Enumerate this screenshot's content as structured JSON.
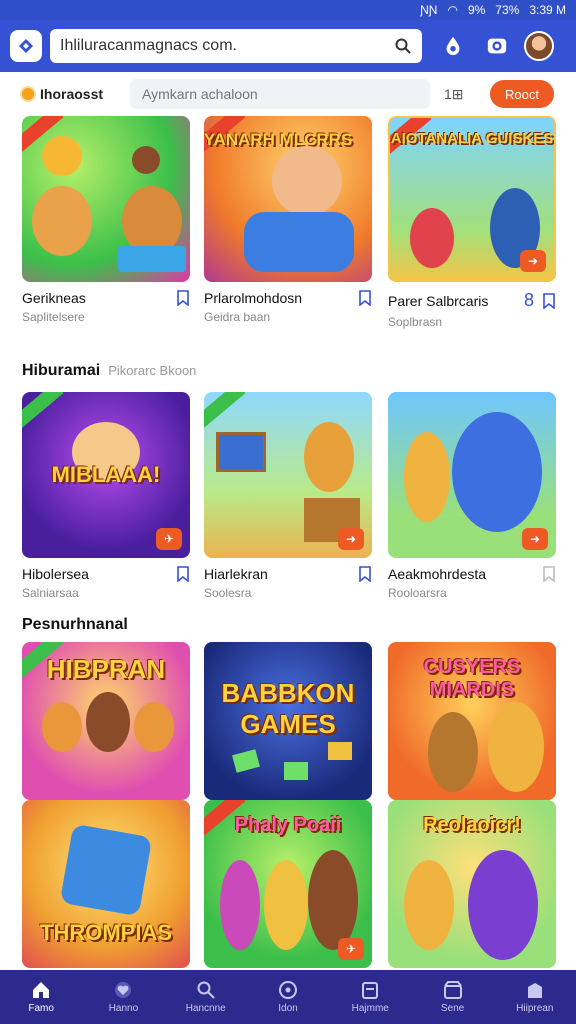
{
  "status_bar": {
    "carrier": "ƝƝ",
    "battery": "9%",
    "signal_text": "73%",
    "time": "3:39 M"
  },
  "header": {
    "search_value": "Ihliluracanmagnacs com."
  },
  "filter": {
    "label": "Ihoraosst",
    "placeholder": "Aymkarn achaloon",
    "grid_toggle": "1⊞",
    "reset_label": "Rooct"
  },
  "sections": [
    {
      "title": "",
      "subtitle": "",
      "cards": [
        {
          "name": "Gerikneas",
          "sub": "Saplitelsere",
          "thumb_title": "",
          "count": ""
        },
        {
          "name": "Prlarolmohdosn",
          "sub": "Geidra baan",
          "thumb_title": "YANARH MLCRRS",
          "count": ""
        },
        {
          "name": "Parer Salbrcaris",
          "sub": "Soplbrasn",
          "thumb_title": "AIOTANALIA GUISKES",
          "count": "8"
        }
      ]
    },
    {
      "title": "Hiburamai",
      "subtitle": "Pikorarc Bkoon",
      "cards": [
        {
          "name": "Hibolersea",
          "sub": "Salniarsaa",
          "thumb_title": "MIBLAAA!",
          "count": ""
        },
        {
          "name": "Hiarlekran",
          "sub": "Soolesra",
          "thumb_title": "",
          "count": ""
        },
        {
          "name": "Aeakmohrdesta",
          "sub": "Rooloarsra",
          "thumb_title": "",
          "count": ""
        }
      ]
    },
    {
      "title": "Pesnurhnanal",
      "subtitle": "",
      "cards": [
        {
          "name": "",
          "sub": "",
          "thumb_title": "HIBPRAN",
          "count": ""
        },
        {
          "name": "",
          "sub": "",
          "thumb_title": "BABBKON GAMES",
          "count": ""
        },
        {
          "name": "",
          "sub": "",
          "thumb_title": "CUSYERS MIARDIS",
          "count": ""
        },
        {
          "name": "",
          "sub": "",
          "thumb_title": "THROMPIAS",
          "count": ""
        },
        {
          "name": "",
          "sub": "",
          "thumb_title": "Phaly Poaii",
          "count": ""
        },
        {
          "name": "",
          "sub": "",
          "thumb_title": "Reolaoicr!",
          "count": ""
        }
      ]
    }
  ],
  "nav": [
    {
      "label": "Famo",
      "icon": "home-icon",
      "active": true
    },
    {
      "label": "Hanno",
      "icon": "heart-icon",
      "active": false
    },
    {
      "label": "Hancnne",
      "icon": "search-icon",
      "active": false
    },
    {
      "label": "Idon",
      "icon": "compass-icon",
      "active": false
    },
    {
      "label": "Hajmme",
      "icon": "calendar-icon",
      "active": false
    },
    {
      "label": "Sene",
      "icon": "store-icon",
      "active": false
    },
    {
      "label": "Hiiprean",
      "icon": "bag-icon",
      "active": false
    }
  ],
  "colors": {
    "primary": "#3552d4",
    "accent": "#ee5a24",
    "nav_bg": "#2c2a8c"
  }
}
